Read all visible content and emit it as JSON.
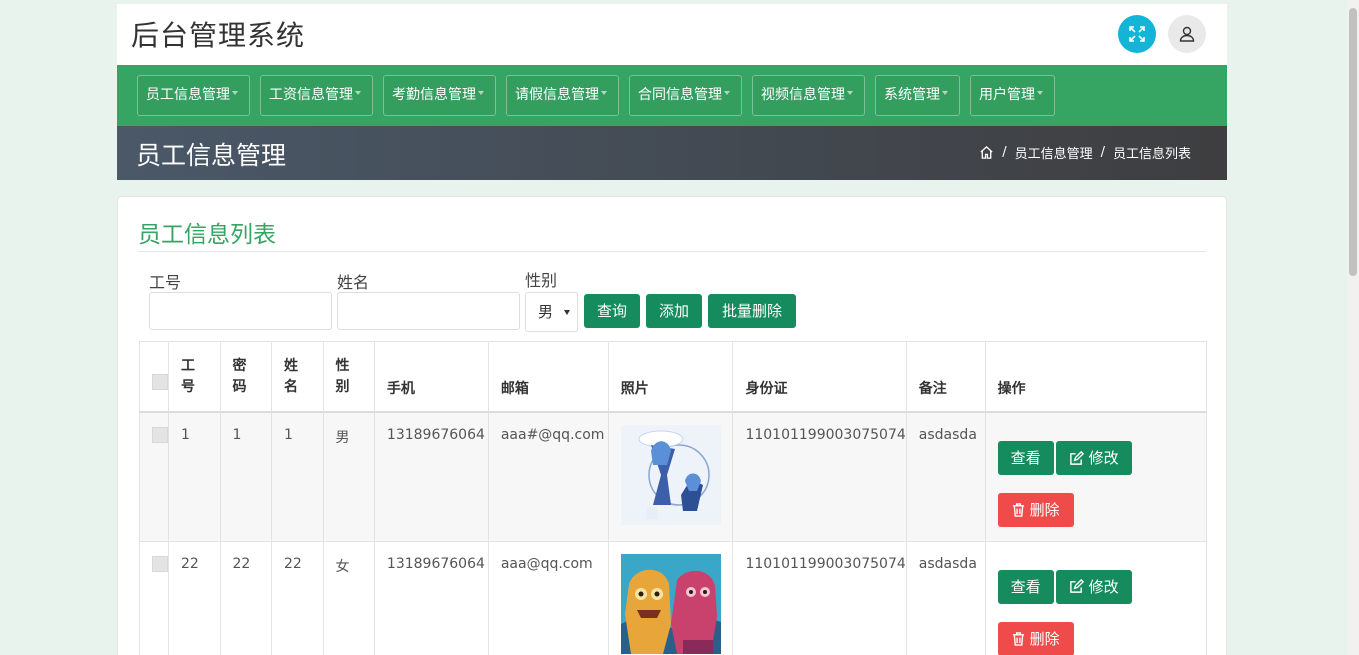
{
  "app": {
    "title": "后台管理系统"
  },
  "nav": {
    "items": [
      {
        "label": "员工信息管理"
      },
      {
        "label": "工资信息管理"
      },
      {
        "label": "考勤信息管理"
      },
      {
        "label": "请假信息管理"
      },
      {
        "label": "合同信息管理"
      },
      {
        "label": "视频信息管理"
      },
      {
        "label": "系统管理"
      },
      {
        "label": "用户管理"
      }
    ]
  },
  "page": {
    "title": "员工信息管理",
    "breadcrumb": {
      "sep": "/",
      "items": [
        "员工信息管理",
        "员工信息列表"
      ]
    }
  },
  "card": {
    "title": "员工信息列表"
  },
  "filters": {
    "emp_no_label": "工号",
    "name_label": "姓名",
    "gender_label": "性别",
    "gender_value": "男",
    "search_btn": "查询",
    "add_btn": "添加",
    "batch_delete_btn": "批量删除"
  },
  "table": {
    "headers": {
      "emp_no": [
        "工",
        "号"
      ],
      "password": [
        "密",
        "码"
      ],
      "name": [
        "姓",
        "名"
      ],
      "gender": [
        "性",
        "别"
      ],
      "phone": "手机",
      "email": "邮箱",
      "photo": "照片",
      "idcard": "身份证",
      "remark": "备注",
      "actions": "操作"
    },
    "rows": [
      {
        "emp_no": "1",
        "password": "1",
        "name": "1",
        "gender": "男",
        "phone": "13189676064",
        "email": "aaa#@qq.com",
        "idcard": "110101199003075074",
        "remark": "asdasda"
      },
      {
        "emp_no": "22",
        "password": "22",
        "name": "22",
        "gender": "女",
        "phone": "13189676064",
        "email": "aaa@qq.com",
        "idcard": "110101199003075074",
        "remark": "asdasda"
      }
    ],
    "actions": {
      "view": "查看",
      "edit": "修改",
      "delete": "删除"
    }
  },
  "colors": {
    "accent": "#36a463",
    "button": "#168c5e",
    "danger": "#f04b4b",
    "expand": "#13b4d5"
  },
  "icons": [
    "expand-icon",
    "user-icon",
    "home-icon",
    "edit-icon",
    "trash-icon"
  ]
}
